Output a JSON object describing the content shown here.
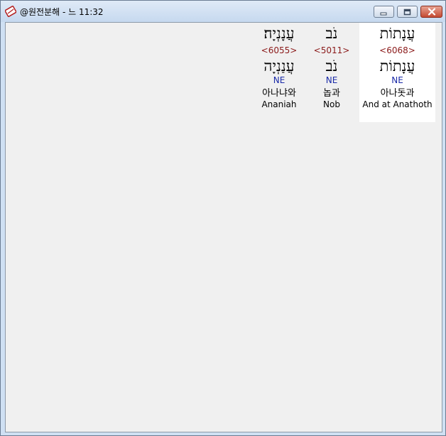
{
  "window": {
    "title": "@원전분해 - 느 11:32",
    "icon": "bible-app-icon",
    "buttons": {
      "minimize": "minimize-icon",
      "maximize": "maximize-icon",
      "close": "close-icon"
    }
  },
  "words": [
    {
      "hebrew": "עֲנָנְיָה׃",
      "strong": "<6055>",
      "hebrew_lemma": "עֲנַנְיָה",
      "pos": "NE",
      "korean": "아나냐와",
      "english": "Ananiah"
    },
    {
      "hebrew": "נֹב",
      "strong": "<5011>",
      "hebrew_lemma": "נֹב",
      "pos": "NE",
      "korean": "놉과",
      "english": "Nob"
    },
    {
      "hebrew": "עֲנָתוֹת",
      "strong": "<6068>",
      "hebrew_lemma": "עֲנָתוֹת",
      "pos": "NE",
      "korean": "아나돗과",
      "english": "And at Anathoth"
    }
  ],
  "colors": {
    "strong": "#8b1a1a",
    "pos": "#1a2aa8",
    "highlight": "#ffffff"
  }
}
